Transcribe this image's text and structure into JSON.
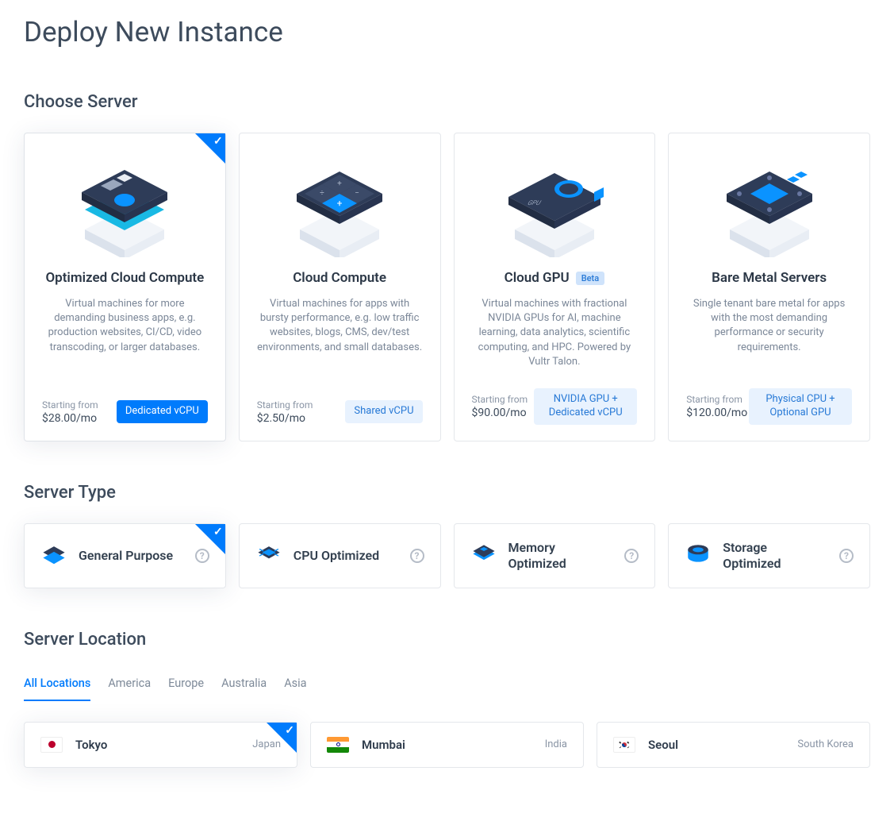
{
  "page_title": "Deploy New Instance",
  "sections": {
    "choose_server": "Choose Server",
    "server_type": "Server Type",
    "server_location": "Server Location"
  },
  "starting_from_label": "Starting from",
  "servers": [
    {
      "title": "Optimized Cloud Compute",
      "desc": "Virtual machines for more demanding business apps, e.g. production websites, CI/CD, video transcoding, or larger databases.",
      "price": "$28.00/mo",
      "cpu_badge": "Dedicated vCPU",
      "badge_style": "solid",
      "selected": true,
      "beta": false
    },
    {
      "title": "Cloud Compute",
      "desc": "Virtual machines for apps with bursty performance, e.g. low traffic websites, blogs, CMS, dev/test environments, and small databases.",
      "price": "$2.50/mo",
      "cpu_badge": "Shared vCPU",
      "badge_style": "light",
      "selected": false,
      "beta": false
    },
    {
      "title": "Cloud GPU",
      "desc": "Virtual machines with fractional NVIDIA GPUs for AI, machine learning, data analytics, scientific computing, and HPC. Powered by Vultr Talon.",
      "price": "$90.00/mo",
      "cpu_badge": "NVIDIA GPU + Dedicated vCPU",
      "badge_style": "light",
      "selected": false,
      "beta": true,
      "beta_label": "Beta"
    },
    {
      "title": "Bare Metal Servers",
      "desc": "Single tenant bare metal for apps with the most demanding performance or security requirements.",
      "price": "$120.00/mo",
      "cpu_badge": "Physical CPU + Optional GPU",
      "badge_style": "light",
      "selected": false,
      "beta": false
    }
  ],
  "types": [
    {
      "label": "General Purpose",
      "selected": true
    },
    {
      "label": "CPU Optimized",
      "selected": false
    },
    {
      "label": "Memory Optimized",
      "selected": false
    },
    {
      "label": "Storage Optimized",
      "selected": false
    }
  ],
  "loc_tabs": [
    {
      "label": "All Locations",
      "active": true
    },
    {
      "label": "America",
      "active": false
    },
    {
      "label": "Europe",
      "active": false
    },
    {
      "label": "Australia",
      "active": false
    },
    {
      "label": "Asia",
      "active": false
    }
  ],
  "locations": [
    {
      "city": "Tokyo",
      "country": "Japan",
      "selected": true,
      "flag": "jp"
    },
    {
      "city": "Mumbai",
      "country": "India",
      "selected": false,
      "flag": "in"
    },
    {
      "city": "Seoul",
      "country": "South Korea",
      "selected": false,
      "flag": "kr"
    }
  ]
}
